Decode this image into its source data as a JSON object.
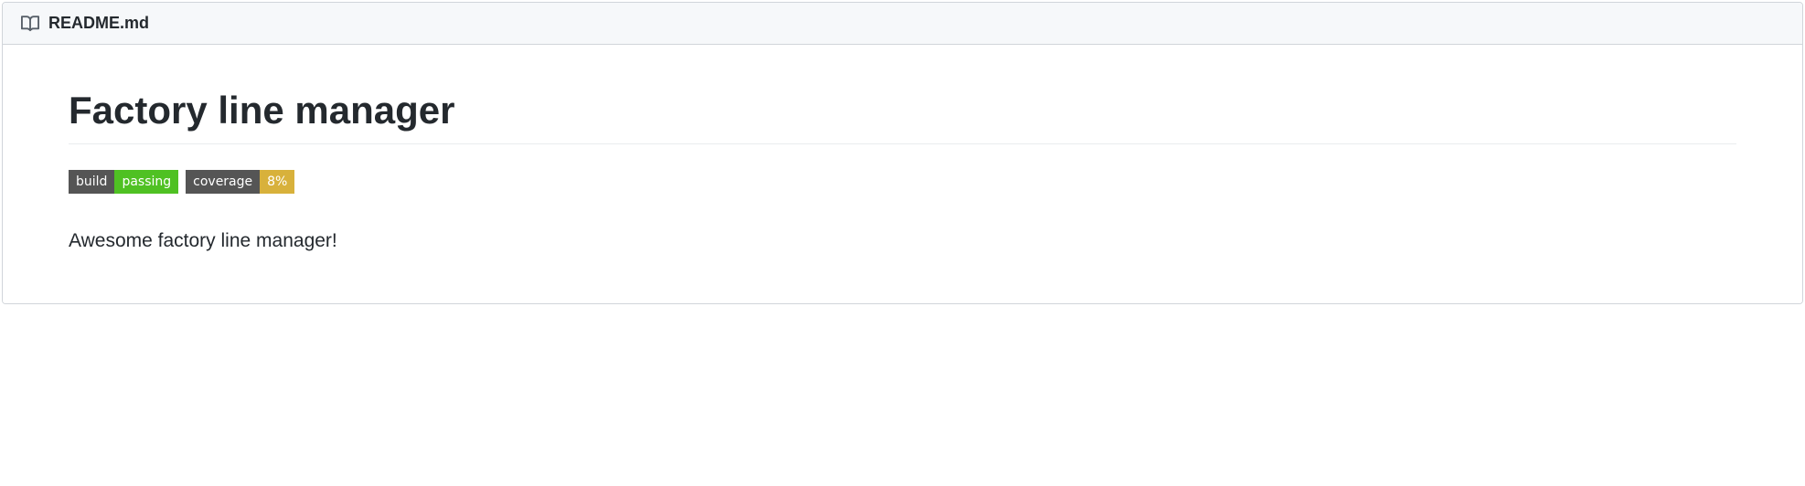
{
  "header": {
    "filename": "README.md"
  },
  "content": {
    "title": "Factory line manager",
    "description": "Awesome factory line manager!"
  },
  "badges": {
    "build": {
      "label": "build",
      "value": "passing"
    },
    "coverage": {
      "label": "coverage",
      "value": "8%"
    }
  }
}
